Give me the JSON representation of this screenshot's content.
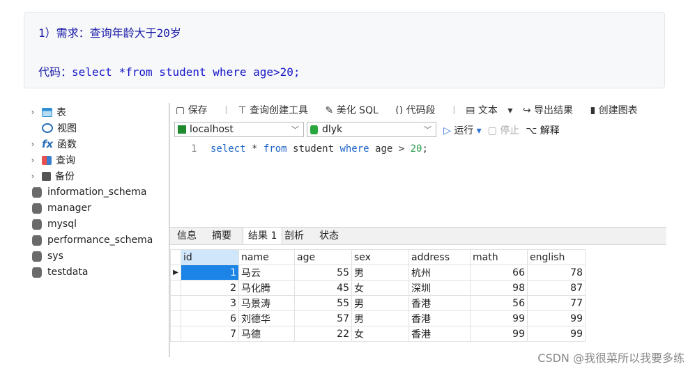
{
  "note": {
    "requirement": "1）需求：查询年龄大于20岁",
    "code_label": "代码：",
    "code": "select *from student where age>20;"
  },
  "tree": {
    "items": [
      {
        "icon": "table-icon",
        "label": "表",
        "expandable": true
      },
      {
        "icon": "view-icon",
        "label": "视图",
        "expandable": false
      },
      {
        "icon": "function-icon",
        "label": "函数",
        "expandable": true
      },
      {
        "icon": "query-icon",
        "label": "查询",
        "expandable": true
      },
      {
        "icon": "backup-icon",
        "label": "备份",
        "expandable": true
      }
    ],
    "databases": [
      "information_schema",
      "manager",
      "mysql",
      "performance_schema",
      "sys",
      "testdata"
    ]
  },
  "toolbar": {
    "save": "保存",
    "query_builder": "查询创建工具",
    "beautify": "美化 SQL",
    "snippet": "代码段",
    "text": "文本",
    "export": "导出结果",
    "chart": "创建图表"
  },
  "connection": {
    "host": "localhost",
    "database": "dlyk"
  },
  "run": {
    "run": "运行",
    "stop": "停止",
    "explain": "解释"
  },
  "editor": {
    "line": "1"
  },
  "result_tabs": [
    "信息",
    "摘要",
    "结果 1",
    "剖析",
    "状态"
  ],
  "table": {
    "columns": [
      "id",
      "name",
      "age",
      "sex",
      "address",
      "math",
      "english"
    ],
    "rows": [
      [
        "1",
        "马云",
        "55",
        "男",
        "杭州",
        "66",
        "78"
      ],
      [
        "2",
        "马化腾",
        "45",
        "女",
        "深圳",
        "98",
        "87"
      ],
      [
        "3",
        "马景涛",
        "55",
        "男",
        "香港",
        "56",
        "77"
      ],
      [
        "6",
        "刘德华",
        "57",
        "男",
        "香港",
        "99",
        "99"
      ],
      [
        "7",
        "马德",
        "22",
        "女",
        "香港",
        "99",
        "99"
      ]
    ]
  },
  "watermark": "CSDN @我很菜所以我要多练"
}
